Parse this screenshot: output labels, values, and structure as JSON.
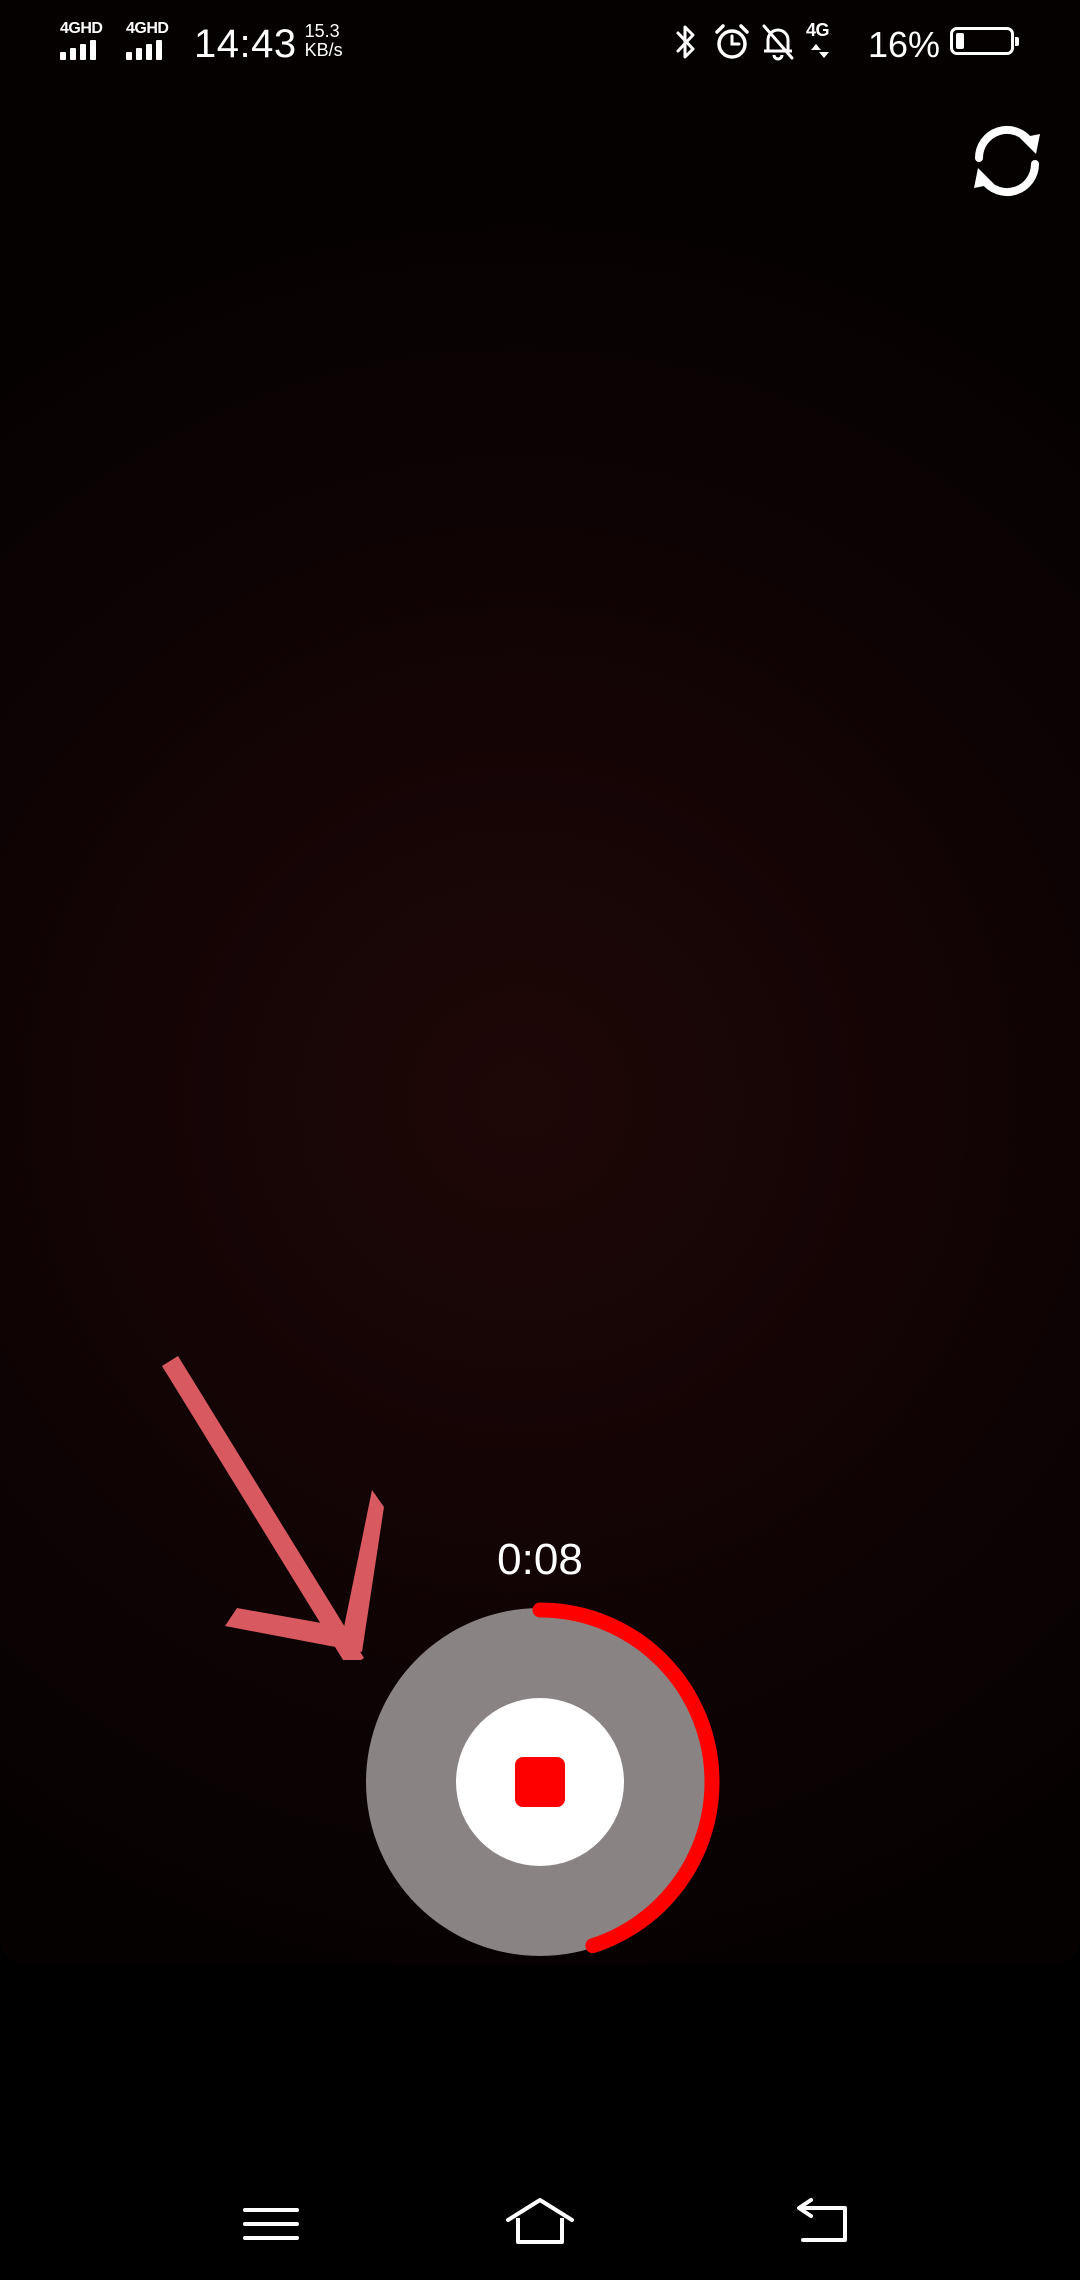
{
  "status_bar": {
    "sim1_label": "4GHD",
    "sim2_label": "4GHD",
    "time": "14:43",
    "speed_value": "15.3",
    "speed_unit": "KB/s",
    "icons": [
      "bluetooth-icon",
      "alarm-icon",
      "bell-off-icon",
      "4g-data-icon"
    ],
    "data_label": "4G",
    "battery_percent": "16%",
    "battery_level": 0.16
  },
  "camera": {
    "switch_icon": "switch-camera-icon",
    "timer": "0:08",
    "record_progress": 0.45,
    "record_state_icon": "stop-icon",
    "accent_color": "#ff0000"
  },
  "annotation": {
    "icon": "arrow-icon",
    "color": "#d85a60"
  },
  "nav_bar": {
    "icons": [
      "menu-icon",
      "home-icon",
      "back-icon"
    ]
  }
}
